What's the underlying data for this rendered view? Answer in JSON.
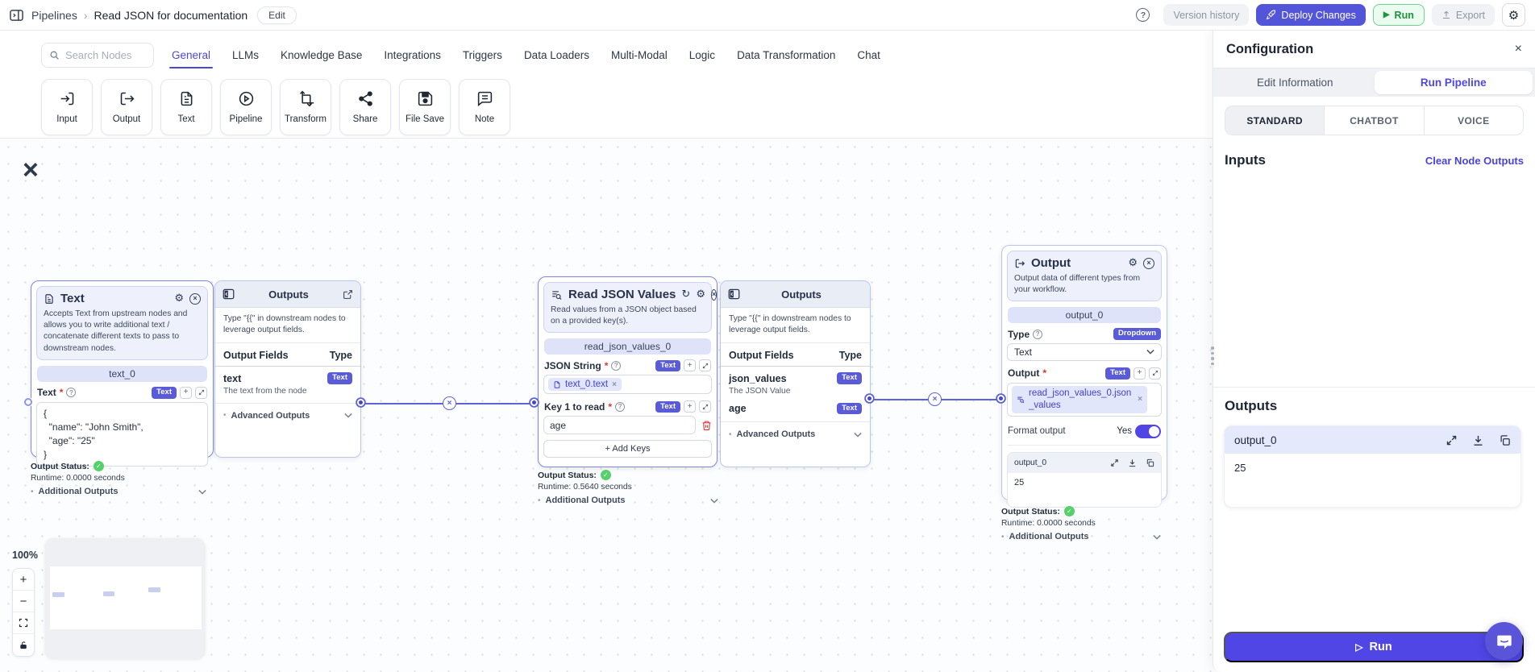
{
  "topbar": {
    "breadcrumb": {
      "section": "Pipelines",
      "separator": "›",
      "page": "Read JSON for documentation"
    },
    "edit_button": "Edit",
    "version_history": "Version history",
    "deploy": "Deploy Changes",
    "run": "Run",
    "export": "Export"
  },
  "palette": {
    "search_placeholder": "Search Nodes",
    "tabs": [
      "General",
      "LLMs",
      "Knowledge Base",
      "Integrations",
      "Triggers",
      "Data Loaders",
      "Multi-Modal",
      "Logic",
      "Data Transformation",
      "Chat"
    ],
    "cards": [
      "Input",
      "Output",
      "Text",
      "Pipeline",
      "Transform",
      "Share",
      "File Save",
      "Note"
    ]
  },
  "canvas": {
    "zoom_level": "100%",
    "text_node": {
      "title": "Text",
      "description": "Accepts Text from upstream nodes and allows you to write additional text / concatenate different texts to pass to downstream nodes.",
      "pill": "text_0",
      "field_label": "Text",
      "type_badge": "Text",
      "value": "{\n  \"name\": \"John Smith\",\n  \"age\": \"25\"\n}"
    },
    "text_status": {
      "label": "Output Status:",
      "runtime": "Runtime: 0.0000 seconds",
      "additional": "Additional Outputs"
    },
    "outputs_panel_1": {
      "title": "Outputs",
      "hint": "Type \"{{\" in downstream nodes to leverage output fields.",
      "col_fields": "Output Fields",
      "col_type": "Type",
      "field_name": "text",
      "field_type": "Text",
      "field_desc": "The text from the node",
      "advanced": "Advanced Outputs"
    },
    "read_json_node": {
      "title": "Read JSON Values",
      "description": "Read values from a JSON object based on a provided key(s).",
      "pill": "read_json_values_0",
      "json_string_label": "JSON String",
      "json_chip": "text_0.text",
      "type_badge": "Text",
      "key_label": "Key 1 to read",
      "key_value": "age",
      "add_keys_button": "+ Add Keys"
    },
    "read_json_status": {
      "label": "Output Status:",
      "runtime": "Runtime: 0.5640 seconds",
      "additional": "Additional Outputs"
    },
    "outputs_panel_2": {
      "title": "Outputs",
      "hint": "Type \"{{\" in downstream nodes to leverage output fields.",
      "col_fields": "Output Fields",
      "col_type": "Type",
      "field1_name": "json_values",
      "field1_type": "Text",
      "field1_desc": "The JSON Value",
      "field2_name": "age",
      "field2_type": "Text",
      "advanced": "Advanced Outputs"
    },
    "output_node": {
      "title": "Output",
      "description": "Output data of different types from your workflow.",
      "pill": "output_0",
      "type_label": "Type",
      "dropdown_badge": "Dropdown",
      "type_value": "Text",
      "output_label": "Output",
      "type_badge": "Text",
      "output_chip": "read_json_values_0.json_values",
      "format_label": "Format output",
      "format_value": "Yes",
      "result_title": "output_0",
      "result_value": "25"
    },
    "output_status": {
      "label": "Output Status:",
      "runtime": "Runtime: 0.0000 seconds",
      "additional": "Additional Outputs"
    }
  },
  "config_panel": {
    "title": "Configuration",
    "tab_edit": "Edit Information",
    "tab_run": "Run Pipeline",
    "mode_standard": "STANDARD",
    "mode_chatbot": "CHATBOT",
    "mode_voice": "VOICE",
    "inputs_heading": "Inputs",
    "clear_link": "Clear Node Outputs",
    "outputs_heading": "Outputs",
    "output_card_title": "output_0",
    "output_card_value": "25",
    "run_button": "Run"
  },
  "icons": {
    "gear": "⚙",
    "refresh": "↻",
    "close": "×",
    "check": "✓",
    "play": "▶",
    "play_outline": "▷",
    "question": "?",
    "plus": "+",
    "minus": "−",
    "bullet": "•",
    "asterisk": "*",
    "chip_close": "×"
  },
  "colors": {
    "accent": "#4f46e5",
    "deploy": "#5355d8",
    "run_green": "#22923e",
    "edge": "#5c63d8",
    "badge": "#5a5bd8"
  }
}
